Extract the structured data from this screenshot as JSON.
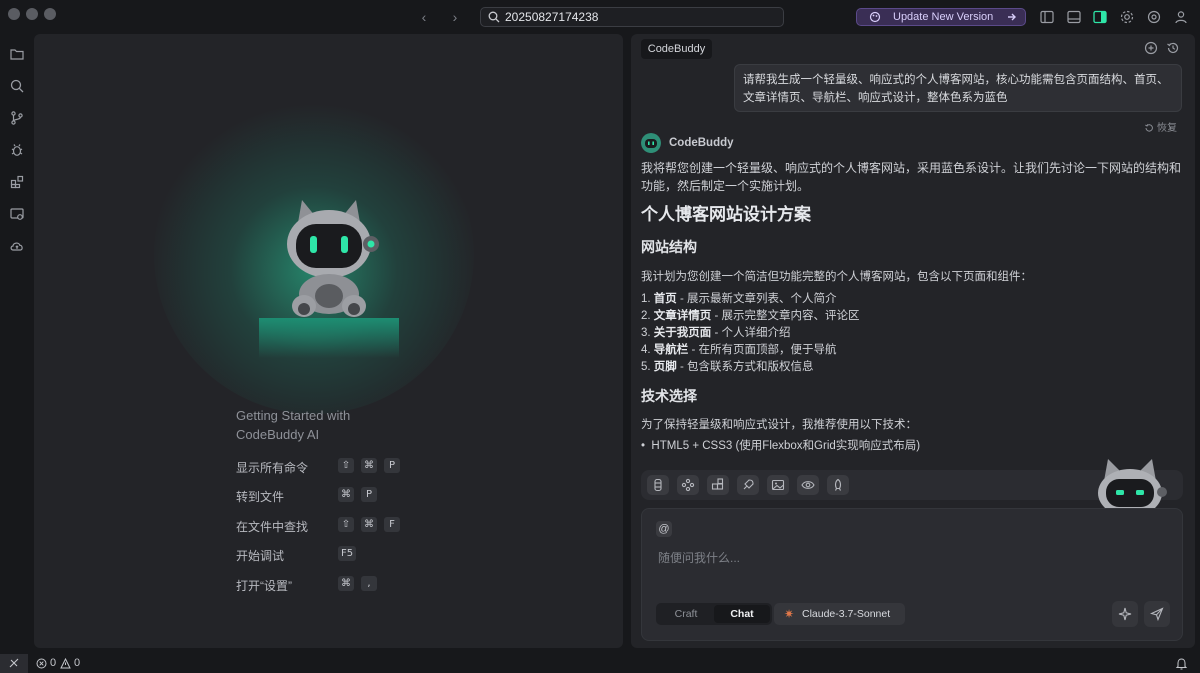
{
  "titlebar": {
    "search_value": "20250827174238",
    "update_label": "Update New Version"
  },
  "welcome": {
    "title_line1": "Getting Started with",
    "title_line2": "CodeBuddy AI",
    "shortcuts": [
      {
        "label": "显示所有命令",
        "keys": [
          "⇧",
          "⌘",
          "P"
        ]
      },
      {
        "label": "转到文件",
        "keys": [
          "⌘",
          "P"
        ]
      },
      {
        "label": "在文件中查找",
        "keys": [
          "⇧",
          "⌘",
          "F"
        ]
      },
      {
        "label": "开始调试",
        "keys": [
          "F5"
        ]
      },
      {
        "label": "打开“设置”",
        "keys": [
          "⌘",
          ","
        ]
      }
    ]
  },
  "chat": {
    "tab_label": "CodeBuddy",
    "user_message": "请帮我生成一个轻量级、响应式的个人博客网站，核心功能需包含页面结构、首页、文章详情页、导航栏、响应式设计，整体色系为蓝色",
    "restore_label": "恢复",
    "bot_name": "CodeBuddy",
    "reply_intro": "我将帮您创建一个轻量级、响应式的个人博客网站，采用蓝色系设计。让我们先讨论一下网站的结构和功能，然后制定一个实施计划。",
    "reply_title": "个人博客网站设计方案",
    "section1_title": "网站结构",
    "section1_text": "我计划为您创建一个简洁但功能完整的个人博客网站，包含以下页面和组件：",
    "structure_items": [
      {
        "num": "1.",
        "name": "首页",
        "desc": " - 展示最新文章列表、个人简介"
      },
      {
        "num": "2.",
        "name": "文章详情页",
        "desc": " - 展示完整文章内容、评论区"
      },
      {
        "num": "3.",
        "name": "关于我页面",
        "desc": " - 个人详细介绍"
      },
      {
        "num": "4.",
        "name": "导航栏",
        "desc": " - 在所有页面顶部，便于导航"
      },
      {
        "num": "5.",
        "name": "页脚",
        "desc": " - 包含联系方式和版权信息"
      }
    ],
    "section2_title": "技术选择",
    "section2_text": "为了保持轻量级和响应式设计，我推荐使用以下技术：",
    "tech_items": [
      "HTML5 + CSS3 (使用Flexbox和Grid实现响应式布局)"
    ],
    "input_placeholder": "随便问我什么...",
    "at_symbol": "@",
    "mode_craft": "Craft",
    "mode_chat": "Chat",
    "model_name": "Claude-3.7-Sonnet"
  },
  "statusbar": {
    "errors": "0",
    "warnings": "0"
  },
  "colors": {
    "accent_green": "#2ee6a8",
    "update_purple": "#5b4a8a",
    "model_star": "#e0784a"
  }
}
